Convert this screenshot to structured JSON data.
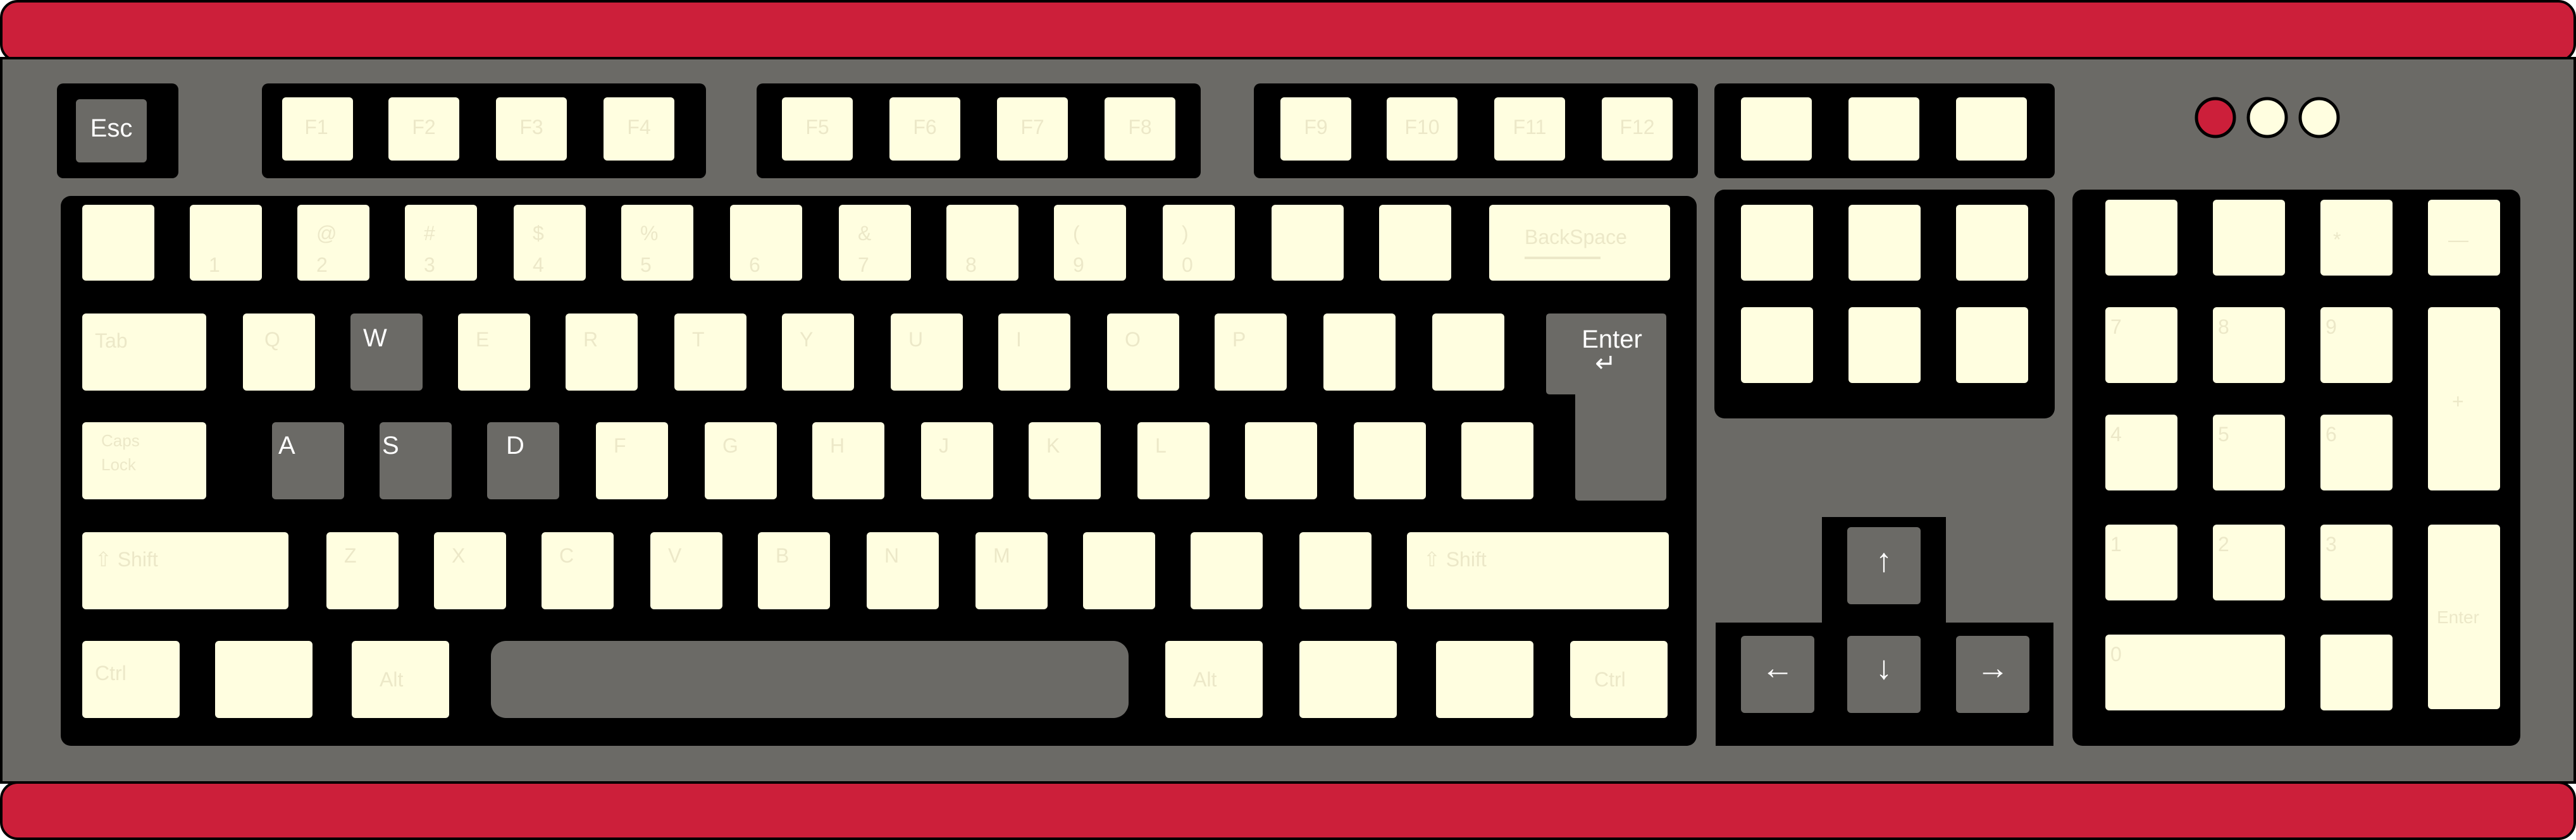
{
  "colors": {
    "frame": "#cc1f3a",
    "body": "#6b6a66",
    "panel": "#000000",
    "key": "#fffee0",
    "key_highlight": "#6b6a66",
    "led_on": "#cc1f3a",
    "led_off": "#fffee0",
    "label": "#ffffff",
    "faint_label": "#ece8c8"
  },
  "highlighted_keys": [
    "Esc",
    "W",
    "A",
    "S",
    "D",
    "Space",
    "Enter",
    "Up",
    "Down",
    "Left",
    "Right"
  ],
  "keys": {
    "esc": "Esc",
    "f1": "F1",
    "f2": "F2",
    "f3": "F3",
    "f4": "F4",
    "f5": "F5",
    "f6": "F6",
    "f7": "F7",
    "f8": "F8",
    "f9": "F9",
    "f10": "F10",
    "f11": "F11",
    "f12": "F12",
    "row1": [
      "",
      "1",
      "2",
      "3",
      "4",
      "5",
      "6",
      "7",
      "8",
      "9",
      "0",
      "",
      ""
    ],
    "row1_symbols": [
      "",
      "",
      "@",
      "#",
      "$",
      "%",
      "",
      "&",
      "",
      "(",
      ")",
      "",
      ""
    ],
    "backspace": "BackSpace",
    "tab": "Tab",
    "row2": [
      "Q",
      "W",
      "E",
      "R",
      "T",
      "Y",
      "U",
      "I",
      "O",
      "P",
      "",
      ""
    ],
    "enter": "Enter",
    "enter_arrow": "↵",
    "caps": "Caps",
    "caps2": "Lock",
    "row3": [
      "A",
      "S",
      "D",
      "F",
      "G",
      "H",
      "J",
      "K",
      "L",
      "",
      ""
    ],
    "shift_left": "⇧ Shift",
    "row4": [
      "Z",
      "X",
      "C",
      "V",
      "B",
      "N",
      "M",
      "",
      "",
      ""
    ],
    "shift_right": "⇧ Shift",
    "ctrl_left": "Ctrl",
    "win_left": "",
    "alt_left": "Alt",
    "alt_right": "Alt",
    "fn_right": "",
    "menu_right": "",
    "ctrl_right": "Ctrl",
    "arrow_up": "↑",
    "arrow_down": "↓",
    "arrow_left": "←",
    "arrow_right": "→",
    "numpad_enter": "Enter",
    "numpad_plus": "+",
    "numpad_zero": "0",
    "numpad_row1": [
      "",
      "",
      "*",
      "—"
    ],
    "numpad_row2": [
      "7",
      "8",
      "9"
    ],
    "numpad_row3": [
      "4",
      "5",
      "6"
    ],
    "numpad_row4": [
      "1",
      "2",
      "3"
    ]
  }
}
